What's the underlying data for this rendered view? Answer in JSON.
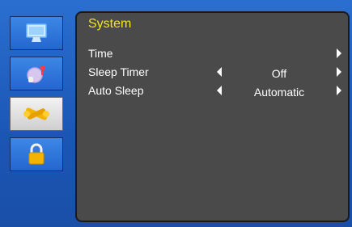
{
  "menu": {
    "title": "System",
    "items": [
      {
        "label": "Time",
        "value": "",
        "has_left_arrow": false,
        "has_right_arrow": true
      },
      {
        "label": "Sleep Timer",
        "value": "Off",
        "has_left_arrow": true,
        "has_right_arrow": true
      },
      {
        "label": "Auto Sleep",
        "value": "Automatic",
        "has_left_arrow": true,
        "has_right_arrow": true
      }
    ]
  },
  "sidebar": {
    "items": [
      {
        "icon": "monitor-icon",
        "selected": false
      },
      {
        "icon": "audio-icon",
        "selected": false
      },
      {
        "icon": "tools-icon",
        "selected": true
      },
      {
        "icon": "lock-icon",
        "selected": false
      }
    ]
  },
  "colors": {
    "background": "#1f5fbf",
    "panel": "#4a4a4a",
    "title": "#f2e619",
    "text": "#ffffff",
    "selected_tab": "#e8e8e8"
  }
}
